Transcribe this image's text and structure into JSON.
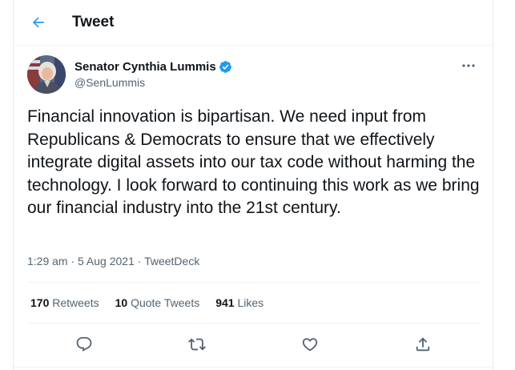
{
  "header": {
    "back_icon": "arrow-left-icon",
    "title": "Tweet"
  },
  "author": {
    "display_name": "Senator Cynthia Lummis",
    "handle": "@SenLummis",
    "verified_icon": "verified-badge-icon",
    "more_icon": "more-horizontal-icon"
  },
  "tweet": {
    "text": "Financial innovation is bipartisan. We need input from Republicans & Democrats to ensure that we effectively integrate digital assets into our tax code without harming the technology. I look forward to continuing this work as we bring our financial industry into the 21st century.",
    "timestamp": "1:29 am · 5 Aug 2021",
    "separator": " · ",
    "source": "TweetDeck"
  },
  "stats": {
    "retweets_count": "170",
    "retweets_label": "Retweets",
    "quotes_count": "10",
    "quotes_label": "Quote Tweets",
    "likes_count": "941",
    "likes_label": "Likes"
  },
  "actions": {
    "reply_icon": "reply-icon",
    "retweet_icon": "retweet-icon",
    "like_icon": "heart-icon",
    "share_icon": "share-icon"
  },
  "colors": {
    "accent": "#1d9bf0",
    "text_primary": "#0f1419",
    "text_secondary": "#536471",
    "divider": "#eff3f4"
  }
}
